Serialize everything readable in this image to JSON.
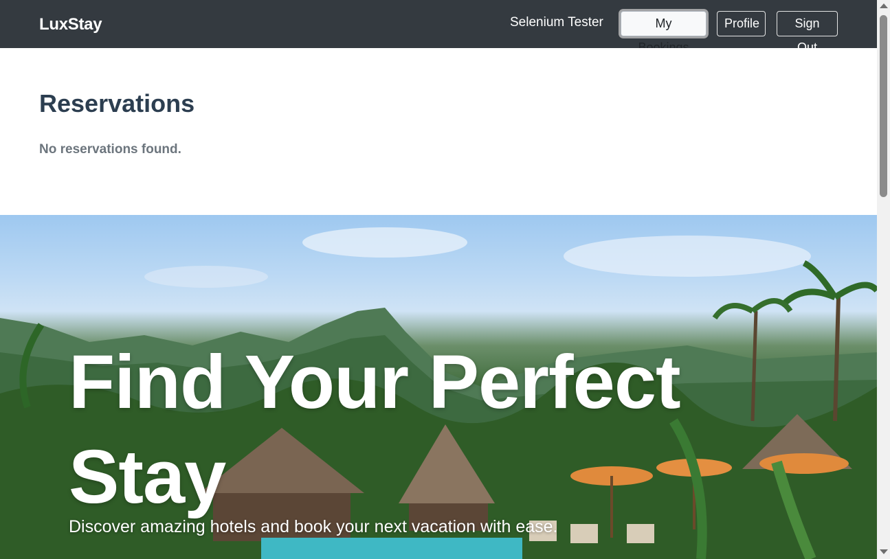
{
  "navbar": {
    "brand": "LuxStay",
    "user_name": "Selenium Tester",
    "buttons": {
      "my_bookings": "My Bookings",
      "profile": "Profile",
      "sign_out": "Sign Out"
    },
    "background_color": "#343a40"
  },
  "main": {
    "title": "Reservations",
    "empty_message": "No reservations found."
  },
  "hero": {
    "title": "Find Your Perfect Stay",
    "subtitle": "Discover amazing hotels and book your next vacation with ease."
  },
  "colors": {
    "title_text": "#2c3e50",
    "muted_text": "#6c757d"
  }
}
